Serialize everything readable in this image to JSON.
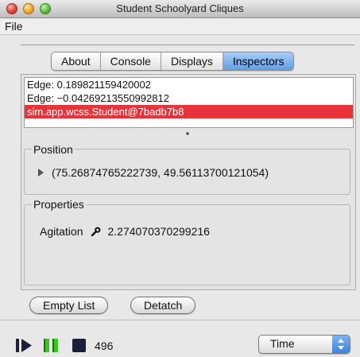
{
  "window": {
    "title": "Student Schoolyard Cliques"
  },
  "menu": {
    "file": "File"
  },
  "tabs": [
    {
      "label": "About"
    },
    {
      "label": "Console"
    },
    {
      "label": "Displays"
    },
    {
      "label": "Inspectors"
    }
  ],
  "inspector_list": [
    {
      "label": "Edge: 0.189821159420002"
    },
    {
      "label": "Edge: −0.04269213550992812"
    },
    {
      "label": "sim.app.wcss.Student@7badb7b8"
    }
  ],
  "position": {
    "legend": "Position",
    "value": "(75.26874765222739, 49.56113700121054)"
  },
  "properties": {
    "legend": "Properties",
    "name": "Agitation",
    "value": "2.274070370299216"
  },
  "buttons": {
    "empty_list": "Empty List",
    "detatch": "Detatch"
  },
  "status": {
    "steps": "496",
    "time_select": "Time"
  },
  "colors": {
    "selection": "#e9333a",
    "active_tab": "#5f9ee8"
  }
}
